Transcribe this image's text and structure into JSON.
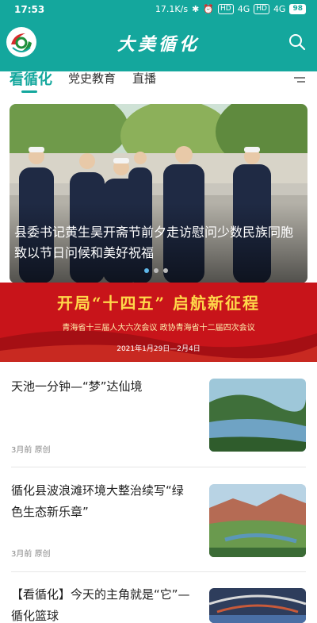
{
  "status": {
    "time": "17:53",
    "speed": "17.1K/s",
    "hd1": "HD",
    "net1": "4G",
    "hd2": "HD",
    "net2": "4G",
    "battery": "98"
  },
  "app": {
    "title": "大美循化"
  },
  "tabs": [
    {
      "label": "看循化"
    },
    {
      "label": "党史教育"
    },
    {
      "label": "直播"
    }
  ],
  "hero": {
    "caption": "县委书记黄生昊开斋节前夕走访慰问少数民族同胞    致以节日问候和美好祝福"
  },
  "banner": {
    "title": "开局“十四五” 启航新征程",
    "sub": "青海省十三届人大六次会议   政协青海省十二届四次会议",
    "date": "2021年1月29日—2月4日"
  },
  "articles": [
    {
      "title": "天池一分钟—“梦”达仙境",
      "time": "3月前",
      "tag": "原创"
    },
    {
      "title": "循化县波浪滩环境大整治续写“绿色生态新乐章”",
      "time": "3月前",
      "tag": "原创"
    },
    {
      "title": "【看循化】今天的主角就是“它”—循化篮球",
      "time": "",
      "tag": ""
    }
  ],
  "colors": {
    "accent": "#14a79d",
    "banner": "#c8141a"
  }
}
